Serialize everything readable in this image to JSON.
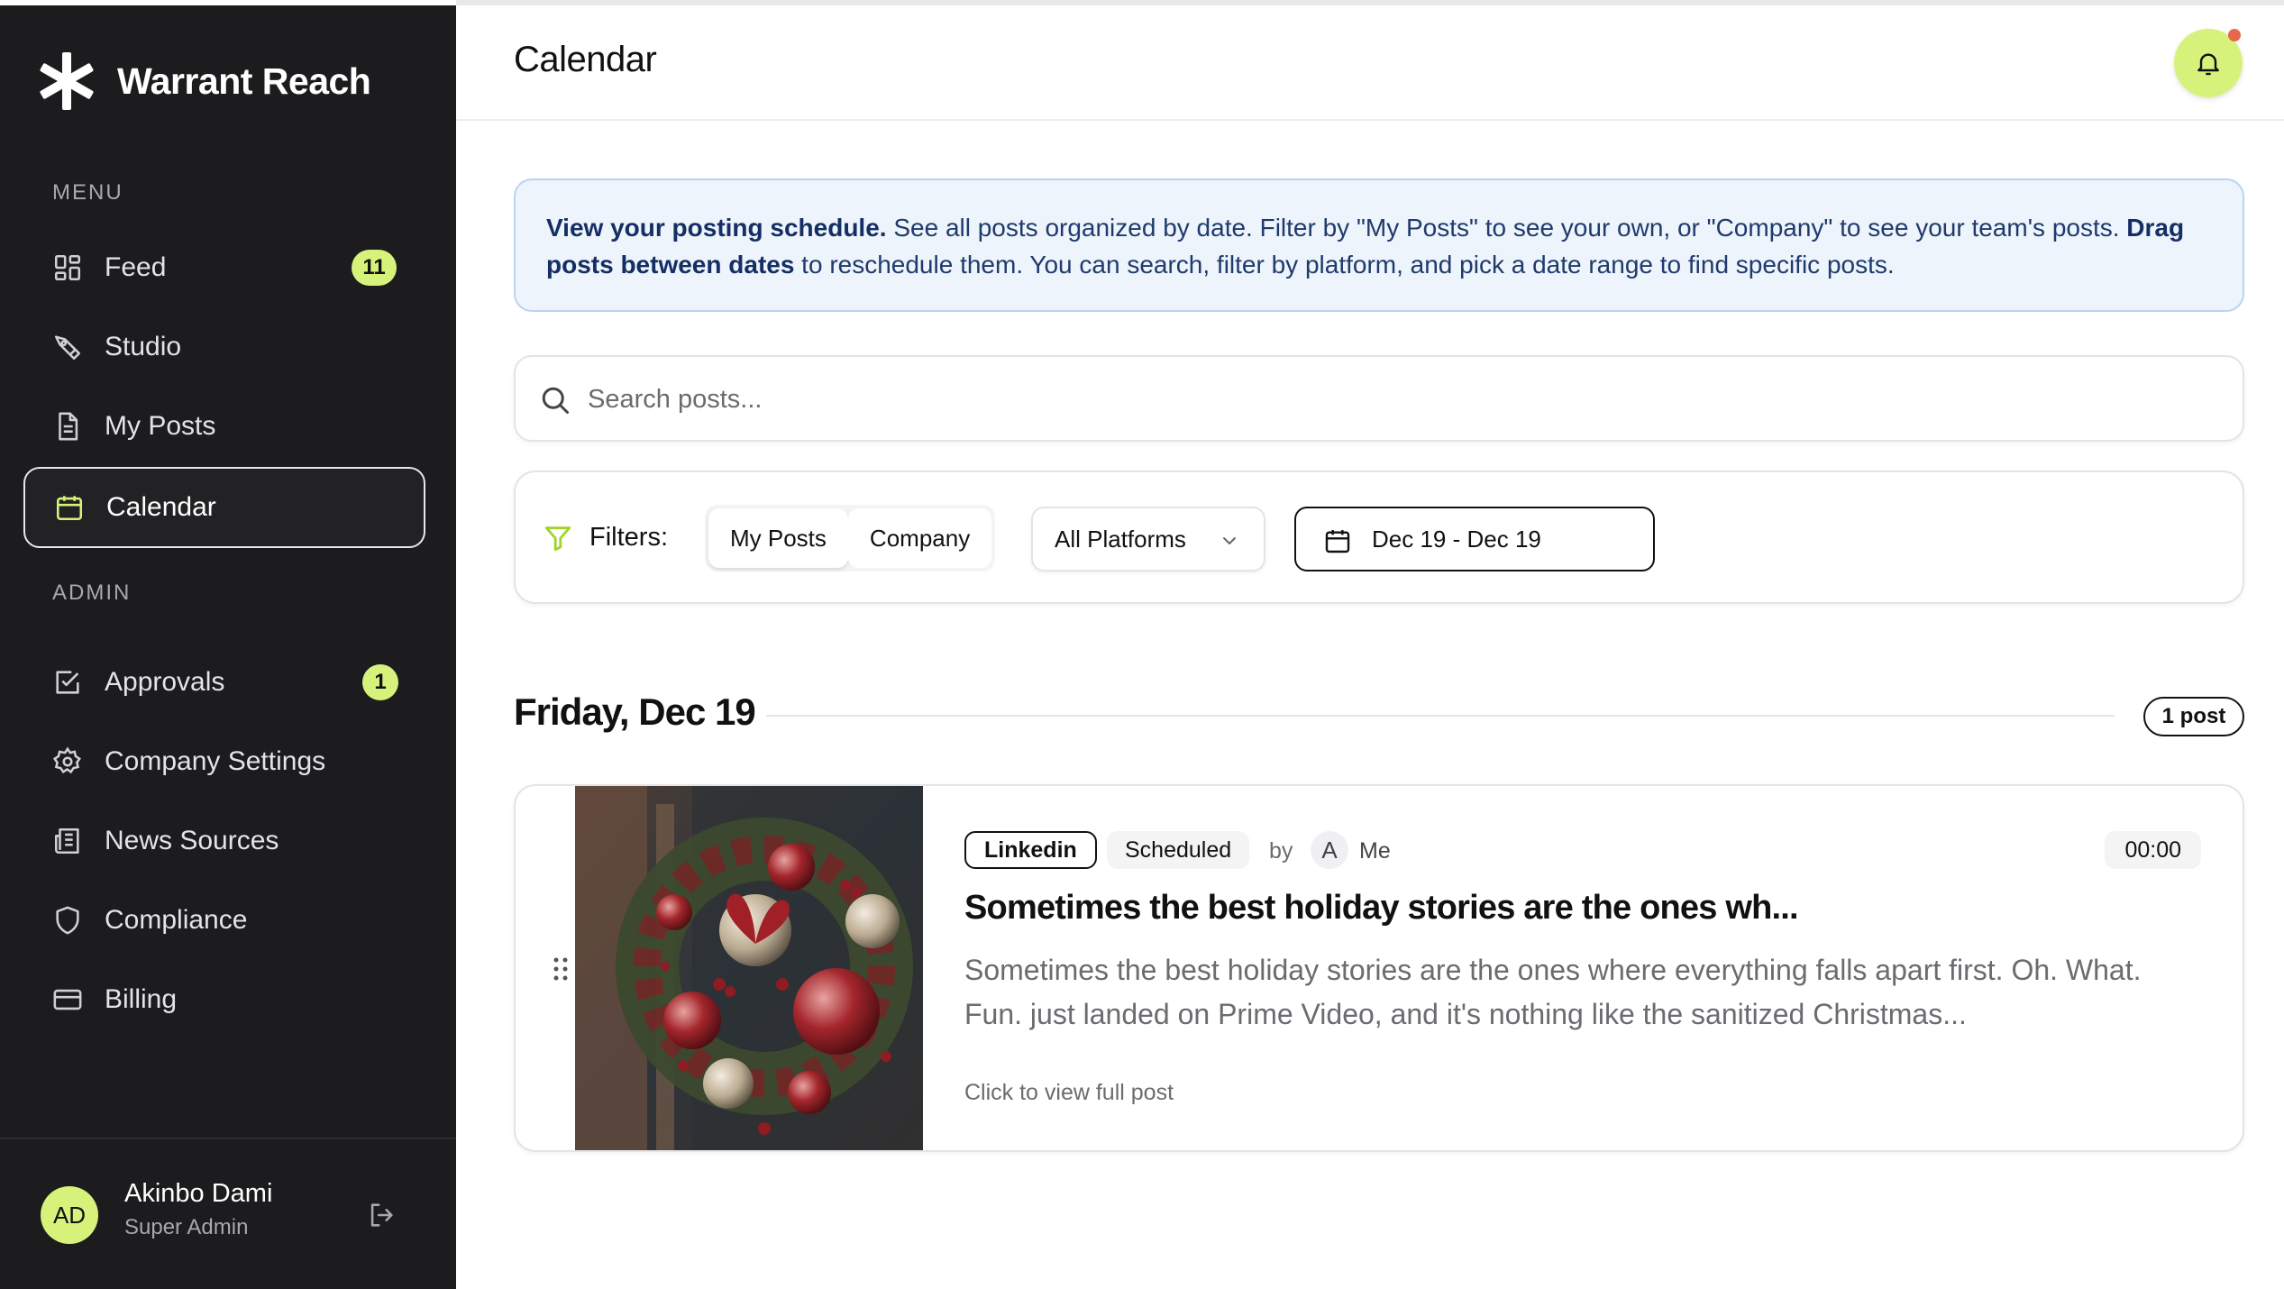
{
  "app": {
    "name": "Warrant Reach"
  },
  "sidebar": {
    "menu_label": "MENU",
    "admin_label": "ADMIN",
    "menu_items": [
      {
        "label": "Feed",
        "icon": "grid-icon",
        "badge": "11"
      },
      {
        "label": "Studio",
        "icon": "pen-tool-icon"
      },
      {
        "label": "My Posts",
        "icon": "document-icon"
      },
      {
        "label": "Calendar",
        "icon": "calendar-icon",
        "active": true
      }
    ],
    "admin_items": [
      {
        "label": "Approvals",
        "icon": "check-square-icon",
        "badge": "1"
      },
      {
        "label": "Company Settings",
        "icon": "gear-icon"
      },
      {
        "label": "News Sources",
        "icon": "newspaper-icon"
      },
      {
        "label": "Compliance",
        "icon": "shield-icon"
      },
      {
        "label": "Billing",
        "icon": "credit-card-icon"
      }
    ],
    "user": {
      "initials": "AD",
      "name": "Akinbo Dami",
      "role": "Super Admin"
    }
  },
  "header": {
    "title": "Calendar"
  },
  "info": {
    "lead": "View your posting schedule.",
    "text1": " See all posts organized by date. Filter by \"My Posts\" to see your own, or \"Company\" to see your team's posts. ",
    "bold2": "Drag posts between dates",
    "text2": " to reschedule them. You can search, filter by platform, and pick a date range to find specific posts."
  },
  "search": {
    "placeholder": "Search posts..."
  },
  "filters": {
    "label": "Filters:",
    "toggle_my_posts": "My Posts",
    "toggle_company": "Company",
    "platform_selected": "All Platforms",
    "date_range": "Dec 19 - Dec 19"
  },
  "day_group": {
    "heading": "Friday, Dec 19",
    "count": "1 post"
  },
  "post": {
    "platform": "Linkedin",
    "status": "Scheduled",
    "by": "by",
    "author_initial": "A",
    "author": "Me",
    "time": "00:00",
    "title": "Sometimes the best holiday stories are the ones wh...",
    "excerpt": "Sometimes the best holiday stories are the ones where everything falls apart first. Oh. What. Fun. just landed on Prime Video, and it's nothing like the sanitized Christmas...",
    "view_link": "Click to view full post"
  },
  "colors": {
    "sidebar_bg": "#1c1c1e",
    "accent_lime": "#d7f27b",
    "info_bg": "#edf4fc",
    "info_border": "#b9d3f0",
    "notification_dot": "#e8664c"
  }
}
